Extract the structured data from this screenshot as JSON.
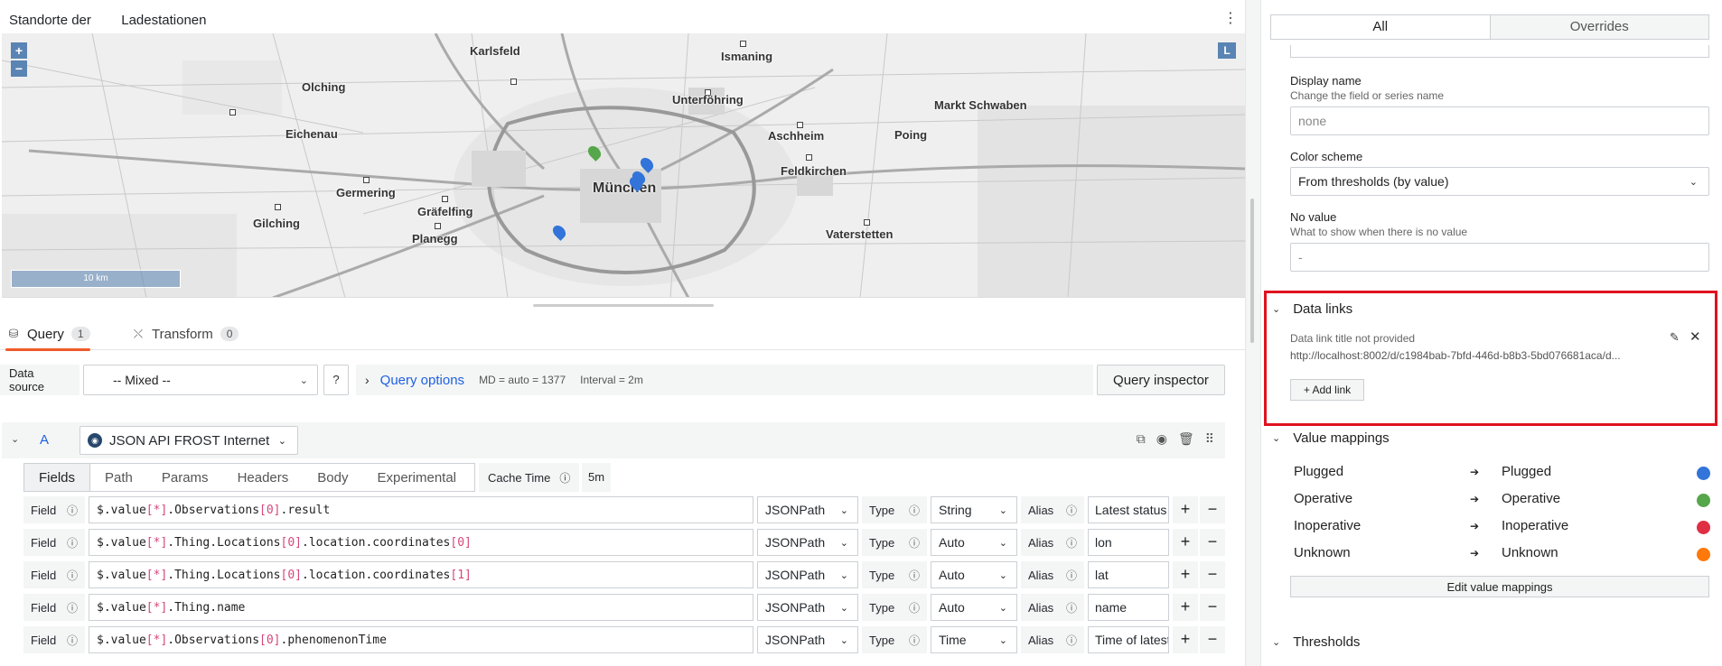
{
  "panel": {
    "title": "Standorte der        Ladestationen",
    "menu_icon": "vertical-dots-icon",
    "map": {
      "zoom_in": "+",
      "zoom_out": "−",
      "layer_toggle": "L",
      "scale_label": "10 km",
      "cities": [
        {
          "name": "Karlsfeld"
        },
        {
          "name": "Ismaning"
        },
        {
          "name": "Olching"
        },
        {
          "name": "Unterföhring"
        },
        {
          "name": "Markt Schwaben"
        },
        {
          "name": "Eichenau"
        },
        {
          "name": "Aschheim"
        },
        {
          "name": "Poing"
        },
        {
          "name": "Feldkirchen"
        },
        {
          "name": "München"
        },
        {
          "name": "Germering"
        },
        {
          "name": "Gräfelfing"
        },
        {
          "name": "Gilching"
        },
        {
          "name": "Planegg"
        },
        {
          "name": "Vaterstetten"
        }
      ],
      "marker_colors": {
        "plugged": "#3274d9",
        "operative": "#56a64b"
      }
    }
  },
  "tabs": [
    {
      "label": "Query",
      "count": "1",
      "icon": "database-icon"
    },
    {
      "label": "Transform",
      "count": "0",
      "icon": "transform-icon"
    }
  ],
  "query_options": {
    "datasource_label": "Data source",
    "datasource_value": "-- Mixed --",
    "help_icon": "question-circle-icon",
    "toggle_label": "Query options",
    "md": "MD = auto = 1377",
    "interval": "Interval = 2m",
    "inspector": "Query inspector"
  },
  "query_a": {
    "letter": "A",
    "datasource": "JSON API FROST Internet",
    "subtabs": [
      "Fields",
      "Path",
      "Params",
      "Headers",
      "Body",
      "Experimental"
    ],
    "cache_label": "Cache Time",
    "cache_value": "5m",
    "fields": [
      {
        "label": "Field",
        "path": [
          {
            "t": "$.value"
          },
          {
            "t": "[*]",
            "b": true
          },
          {
            "t": ".Observations"
          },
          {
            "t": "[0]",
            "b": true
          },
          {
            "t": ".result"
          }
        ],
        "lang": "JSONPath",
        "type_label": "Type",
        "type": "String",
        "alias_label": "Alias",
        "alias": "Latest status"
      },
      {
        "label": "Field",
        "path": [
          {
            "t": "$.value"
          },
          {
            "t": "[*]",
            "b": true
          },
          {
            "t": ".Thing.Locations"
          },
          {
            "t": "[0]",
            "b": true
          },
          {
            "t": ".location.coordinates"
          },
          {
            "t": "[0]",
            "b": true
          }
        ],
        "lang": "JSONPath",
        "type_label": "Type",
        "type": "Auto",
        "alias_label": "Alias",
        "alias": "lon"
      },
      {
        "label": "Field",
        "path": [
          {
            "t": "$.value"
          },
          {
            "t": "[*]",
            "b": true
          },
          {
            "t": ".Thing.Locations"
          },
          {
            "t": "[0]",
            "b": true
          },
          {
            "t": ".location.coordinates"
          },
          {
            "t": "[1]",
            "b": true
          }
        ],
        "lang": "JSONPath",
        "type_label": "Type",
        "type": "Auto",
        "alias_label": "Alias",
        "alias": "lat"
      },
      {
        "label": "Field",
        "path": [
          {
            "t": "$.value"
          },
          {
            "t": "[*]",
            "b": true
          },
          {
            "t": ".Thing.name"
          }
        ],
        "lang": "JSONPath",
        "type_label": "Type",
        "type": "Auto",
        "alias_label": "Alias",
        "alias": "name"
      },
      {
        "label": "Field",
        "path": [
          {
            "t": "$.value"
          },
          {
            "t": "[*]",
            "b": true
          },
          {
            "t": ".Observations"
          },
          {
            "t": "[0]",
            "b": true
          },
          {
            "t": ".phenomenonTime"
          }
        ],
        "lang": "JSONPath",
        "type_label": "Type",
        "type": "Time",
        "alias_label": "Alias",
        "alias": "Time of latest"
      }
    ]
  },
  "options": {
    "seg_all": "All",
    "seg_overrides": "Overrides",
    "display_name": {
      "label": "Display name",
      "desc": "Change the field or series name",
      "placeholder": "none"
    },
    "color_scheme": {
      "label": "Color scheme",
      "value": "From thresholds (by value)"
    },
    "no_value": {
      "label": "No value",
      "desc": "What to show when there is no value",
      "placeholder": "-"
    },
    "data_links": {
      "header": "Data links",
      "title": "Data link title not provided",
      "url": "http://localhost:8002/d/c1984bab-7bfd-446d-b8b3-5bd076681aca/d...",
      "add": "+ Add link"
    },
    "value_mappings": {
      "header": "Value mappings",
      "rows": [
        {
          "from": "Plugged",
          "to": "Plugged",
          "color": "#3274d9"
        },
        {
          "from": "Operative",
          "to": "Operative",
          "color": "#56a64b"
        },
        {
          "from": "Inoperative",
          "to": "Inoperative",
          "color": "#e02f44"
        },
        {
          "from": "Unknown",
          "to": "Unknown",
          "color": "#ff780a"
        }
      ],
      "edit": "Edit value mappings"
    },
    "thresholds_header": "Thresholds"
  }
}
